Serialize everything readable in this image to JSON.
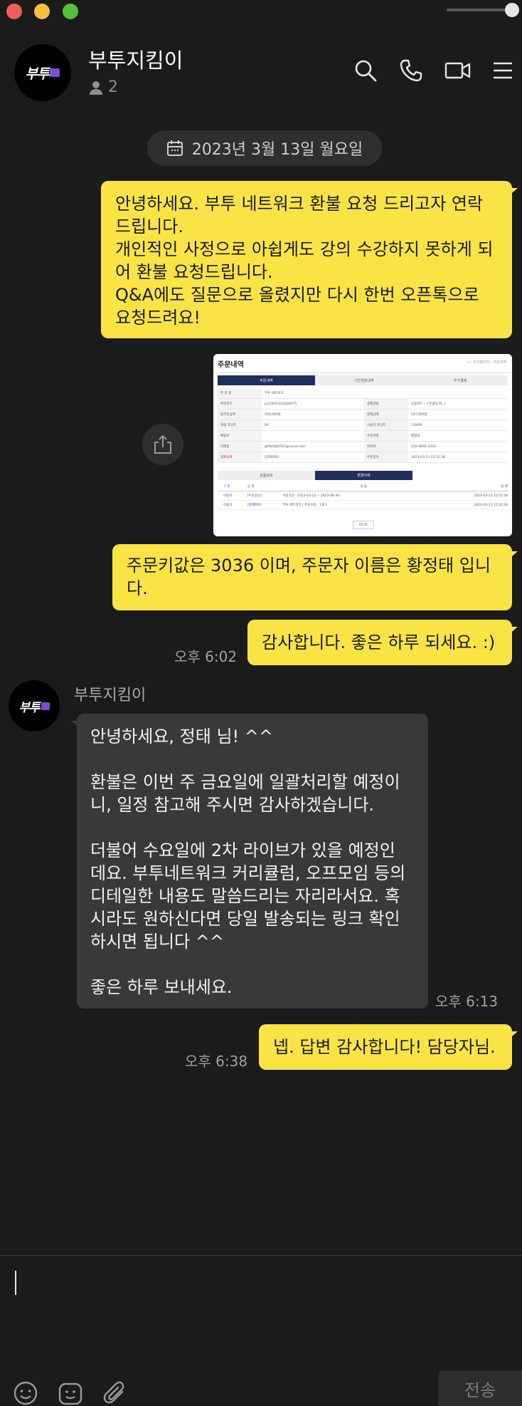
{
  "window": {
    "colors": {
      "close": "#ee5f57",
      "minimize": "#f7be40",
      "maximize": "#57c038"
    }
  },
  "header": {
    "avatar_text": "부투",
    "title": "부투지킴이",
    "member_count": "2",
    "icons": [
      "search-icon",
      "phone-icon",
      "video-icon",
      "menu-icon"
    ]
  },
  "date_divider": "2023년 3월 13일 월요일",
  "messages": {
    "m1": {
      "l1": "안녕하세요. 부투 네트워크 환불 요청 드리고자 연락",
      "l2": "드립니다.",
      "l3": "개인적인 사정으로 아쉽게도 강의 수강하지 못하게 되",
      "l4": "어 환불 요청드립니다.",
      "l5": "Q&A에도 질문으로 올렸지만 다시 한번 오픈톡으로",
      "l6": "요청드려요!"
    },
    "m2": {
      "l1": "주문키값은 3036 이며, 주문자 이름은 황정태 입니",
      "l2": "다."
    },
    "m3": {
      "text": "감사합니다. 좋은 하루 되세요. :)",
      "time": "오후 6:02"
    },
    "reply": {
      "sender": "부투지킴이",
      "avatar_text": "부투",
      "l1": "안녕하세요, 정태 님! ^^",
      "l2": "환불은 이번 주 금요일에 일괄처리할 예정이",
      "l3": "니, 일정 참고해 주시면 감사하겠습니다.",
      "l4": "더불어 수요일에 2차 라이브가 있을 예정인",
      "l5": "데요. 부투네트워크 커리큘럼, 오프모임 등의",
      "l6": "디테일한 내용도 말씀드리는 자리라서요. 혹",
      "l7": "시라도 원하신다면 당일 발송되는 링크 확인",
      "l8": "하시면 됩니다 ^^",
      "l9": "좋은 하루 보내세요.",
      "time": "오후 6:13"
    },
    "m4": {
      "text": "넵. 답변 감사합니다! 담당자님.",
      "time": "오후 6:38"
    }
  },
  "screenshot": {
    "title": "주문내역",
    "tabs": [
      "주문내역",
      "기간연장내역",
      "추가결제"
    ],
    "rows": [
      [
        "주 문 명",
        "부투 네트워크",
        "",
        ""
      ],
      [
        "주문번호",
        "pc23031322284475",
        "결제방법",
        "신용카드 ( 구분없음 PC )"
      ],
      [
        "총주문금액",
        "550,000원",
        "결제금액",
        "547,000원"
      ],
      [
        "적립 포인트",
        "0P",
        "사용한 포인트",
        "3,000P"
      ],
      [
        "배송비",
        "",
        "주문자명",
        "황정태"
      ],
      [
        "이메일",
        "gtfdsfjdj9322@naver.com",
        "연락처",
        "010-4802-2332"
      ],
      [
        "결제상태",
        "[결제완료]",
        "주문일자",
        "2023-03-13 22:52:28"
      ]
    ],
    "sub_tabs": [
      "상품정보",
      "변경이력"
    ],
    "hist_headers": [
      "구 분",
      "상 태",
      "내 용",
      "날 짜"
    ],
    "hist_rows": [
      [
        "이용자",
        "[수강승인]",
        "수강기간 : 2023-03-13 ~ 2023-06-30",
        "2023-03-13 22:52:28"
      ],
      [
        "이용자",
        "[결제완료]",
        "부투 네트워크 [ 주문수량 : 1개 ]",
        "2023-03-13 22:52:28"
      ]
    ],
    "list_button": "리스트"
  },
  "composer": {
    "send_label": "전송",
    "icons": [
      "emoji-icon",
      "emoticon-icon",
      "attach-icon"
    ]
  }
}
